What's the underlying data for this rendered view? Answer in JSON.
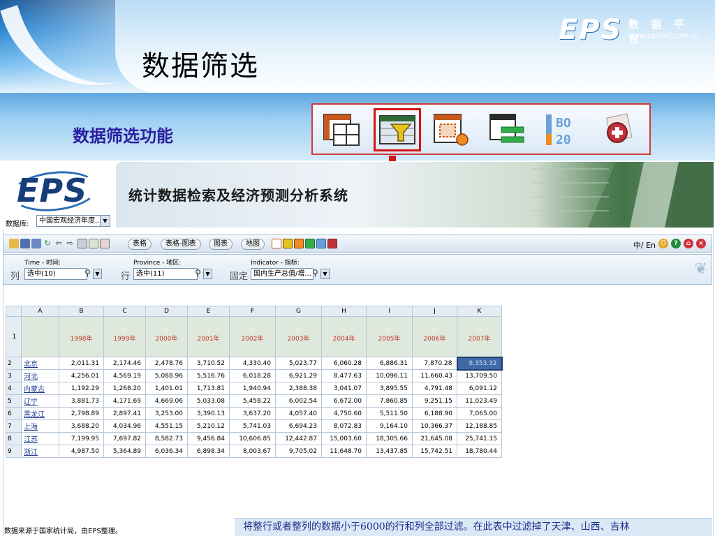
{
  "slide": {
    "title": "数据筛选",
    "subtitle": "数据筛选功能",
    "logo": {
      "brand": "EPS",
      "cn": "数 据 平 台",
      "url": "www.epsnet.com.cn"
    },
    "icons": [
      "table-layout-icon",
      "filter-icon",
      "chart-settings-icon",
      "list-layout-icon",
      "numbering-icon",
      "add-item-icon"
    ],
    "selected_icon": "filter-icon",
    "source_note": "数据来源于国家统计局，由EPS整理。",
    "caption": "将整行或者整列的数据小于6000的行和列全部过滤。在此表中过滤掉了天津、山西、吉林"
  },
  "app": {
    "brand": "EPS",
    "system_title": "统计数据检索及经济预测分析系统",
    "database_label": "数据库:",
    "database_value": "中国宏观经济年度...",
    "toolbar": {
      "buttons": [
        "表格",
        "表格-图表",
        "图表",
        "地图"
      ],
      "language": "中/ En"
    },
    "filters": {
      "col": {
        "axis": "列",
        "caption": "Time - 时间:",
        "value": "选中(10)"
      },
      "row": {
        "axis": "行",
        "caption": "Province - 地区:",
        "value": "选中(11)"
      },
      "fixed": {
        "axis": "固定",
        "caption": "Indicator - 指标:",
        "value": "国内生产总值/增..."
      }
    },
    "grid": {
      "col_letters": [
        "A",
        "B",
        "C",
        "D",
        "E",
        "F",
        "G",
        "H",
        "I",
        "J",
        "K"
      ],
      "years": [
        "1998年",
        "1999年",
        "2000年",
        "2001年",
        "2002年",
        "2003年",
        "2004年",
        "2005年",
        "2006年",
        "2007年"
      ],
      "rows": [
        {
          "num": "2",
          "name": "北京",
          "values": [
            "2,011.31",
            "2,174.46",
            "2,478.76",
            "3,710.52",
            "4,330.40",
            "5,023.77",
            "6,060.28",
            "6,886.31",
            "7,870.28",
            "9,353.32"
          ]
        },
        {
          "num": "3",
          "name": "河北",
          "values": [
            "4,256.01",
            "4,569.19",
            "5,088.96",
            "5,516.76",
            "6,018.28",
            "6,921.29",
            "8,477.63",
            "10,096.11",
            "11,660.43",
            "13,709.50"
          ]
        },
        {
          "num": "4",
          "name": "内蒙古",
          "values": [
            "1,192.29",
            "1,268.20",
            "1,401.01",
            "1,713.81",
            "1,940.94",
            "2,388.38",
            "3,041.07",
            "3,895.55",
            "4,791.48",
            "6,091.12"
          ]
        },
        {
          "num": "5",
          "name": "辽宁",
          "values": [
            "3,881.73",
            "4,171.69",
            "4,669.06",
            "5,033.08",
            "5,458.22",
            "6,002.54",
            "6,672.00",
            "7,860.85",
            "9,251.15",
            "11,023.49"
          ]
        },
        {
          "num": "6",
          "name": "黑龙江",
          "values": [
            "2,798.89",
            "2,897.41",
            "3,253.00",
            "3,390.13",
            "3,637.20",
            "4,057.40",
            "4,750.60",
            "5,511.50",
            "6,188.90",
            "7,065.00"
          ]
        },
        {
          "num": "7",
          "name": "上海",
          "values": [
            "3,688.20",
            "4,034.96",
            "4,551.15",
            "5,210.12",
            "5,741.03",
            "6,694.23",
            "8,072.83",
            "9,164.10",
            "10,366.37",
            "12,188.85"
          ]
        },
        {
          "num": "8",
          "name": "江苏",
          "values": [
            "7,199.95",
            "7,697.82",
            "8,582.73",
            "9,456.84",
            "10,606.85",
            "12,442.87",
            "15,003.60",
            "18,305.66",
            "21,645.08",
            "25,741.15"
          ]
        },
        {
          "num": "9",
          "name": "浙江",
          "values": [
            "4,987.50",
            "5,364.89",
            "6,036.34",
            "6,898.34",
            "8,003.67",
            "9,705.02",
            "11,648.70",
            "13,437.85",
            "15,742.51",
            "18,780.44"
          ]
        }
      ]
    }
  }
}
